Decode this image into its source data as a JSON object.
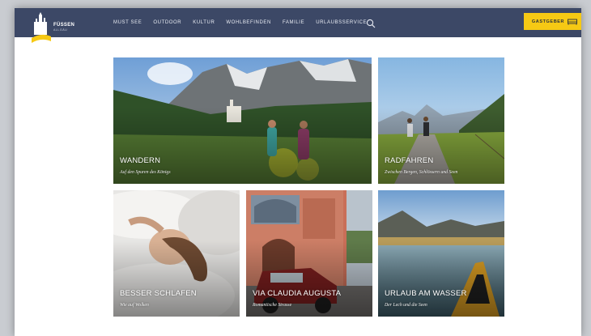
{
  "brand": {
    "name": "FÜSSEN",
    "sub": "ALLGÄU"
  },
  "nav": {
    "items": [
      "MUST SEE",
      "OUTDOOR",
      "KULTUR",
      "WOHLBEFINDEN",
      "FAMILIE",
      "URLAUBSSERVICE"
    ],
    "search_icon": "search-icon",
    "host_label": "GASTGEBER",
    "host_icon": "bed-icon"
  },
  "tiles": [
    {
      "title": "WANDERN",
      "subtitle": "Auf den Spuren des Königs"
    },
    {
      "title": "RADFAHREN",
      "subtitle": "Zwischen Bergen, Schlössern und Seen"
    },
    {
      "title": "BESSER SCHLAFEN",
      "subtitle": "Wie auf Wolken"
    },
    {
      "title": "VIA CLAUDIA AUGUSTA",
      "subtitle": "Romantische Strasse"
    },
    {
      "title": "URLAUB AM WASSER",
      "subtitle": "Der Lech und die Seen"
    }
  ],
  "colors": {
    "nav_bg": "#3c4866",
    "accent": "#f6c914"
  }
}
